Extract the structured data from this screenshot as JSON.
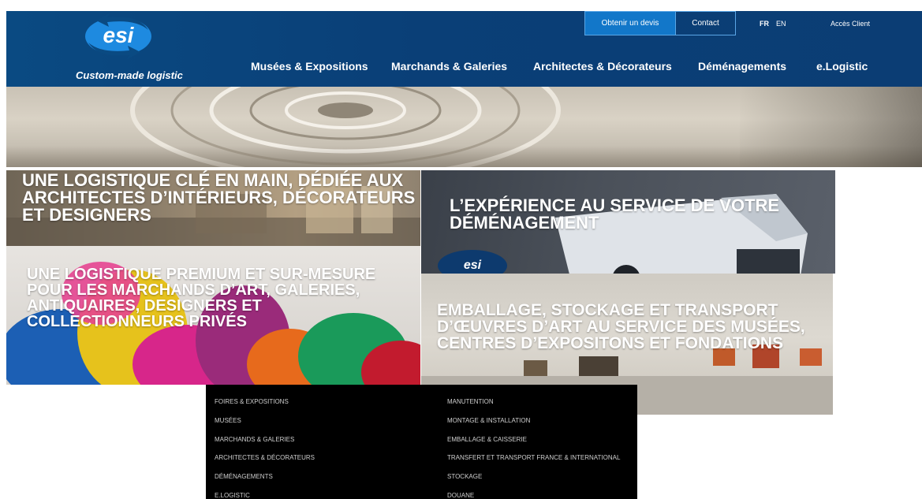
{
  "header": {
    "logo_text": "esi",
    "tagline": "Custom-made logistic",
    "top_buttons": {
      "quote": "Obtenir un devis",
      "contact": "Contact"
    },
    "languages": {
      "fr": "FR",
      "en": "EN"
    },
    "client_access": "Accès Client",
    "nav": [
      {
        "label": "Musées & Expositions"
      },
      {
        "label": "Marchands & Galeries"
      },
      {
        "label": "Architectes & Décorateurs"
      },
      {
        "label": "Déménagements"
      },
      {
        "label": "e.Logistic"
      }
    ]
  },
  "tiles": {
    "architects": "Une logistique clé en main, dédiée aux architectes d’intérieurs, décorateurs et designers",
    "moving": "L’expérience au service de votre déménagement",
    "dealers": "Une logistique premium et sur-mesure pour les marchands d’art, galeries, antiquaires, designers et collectionneurs privés",
    "museums": "Emballage, stockage et transport d’œuvres d’art au service des musées, centres d’expositons et fondations"
  },
  "footer_menu": {
    "left": [
      "FOIRES & EXPOSITIONS",
      "MUSÉES",
      "MARCHANDS & GALERIES",
      "ARCHITECTES & DÉCORATEURS",
      "DÉMÉNAGEMENTS",
      "E.LOGISTIC"
    ],
    "right": [
      "MANUTENTION",
      "MONTAGE & INSTALLATION",
      "EMBALLAGE & CAISSERIE",
      "TRANSFERT ET TRANSPORT FRANCE & INTERNATIONAL",
      "STOCKAGE",
      "DOUANE"
    ]
  },
  "colors": {
    "header_blue": "#0a4a82",
    "quote_button": "#1277c9",
    "footer_bg": "#000000"
  }
}
